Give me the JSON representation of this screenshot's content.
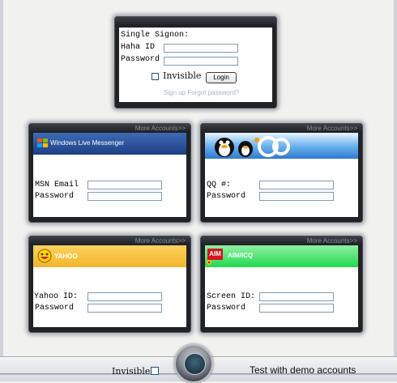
{
  "signon": {
    "title": "Single Signon:",
    "haha_id_label": "Haha ID",
    "password_label": "Password",
    "invisible_label": "Invisible",
    "login_label": "Login",
    "links": "Sign up Forgot password?"
  },
  "more_accounts": "More Accounts>>",
  "msn": {
    "logo_text": "Windows Live Messenger",
    "email_label": "MSN Email",
    "password_label": "Password",
    "banner_color": "#1f3f86"
  },
  "qq": {
    "number_label": "QQ #:",
    "password_label": "Password",
    "banner_color": "#3a8fd9"
  },
  "yahoo": {
    "logo_text": "YAHOO",
    "id_label": "Yahoo ID:",
    "password_label": "Password",
    "banner_color": "#f2b52a"
  },
  "aim": {
    "logo_badge": "AIM",
    "logo_text": "AIM/ICQ",
    "screen_label": "Screen ID:",
    "password_label": "Password",
    "banner_color": "#22d94d"
  },
  "footer": {
    "invisible_label": "Invisible",
    "demo_label": "Test with demo accounts"
  }
}
